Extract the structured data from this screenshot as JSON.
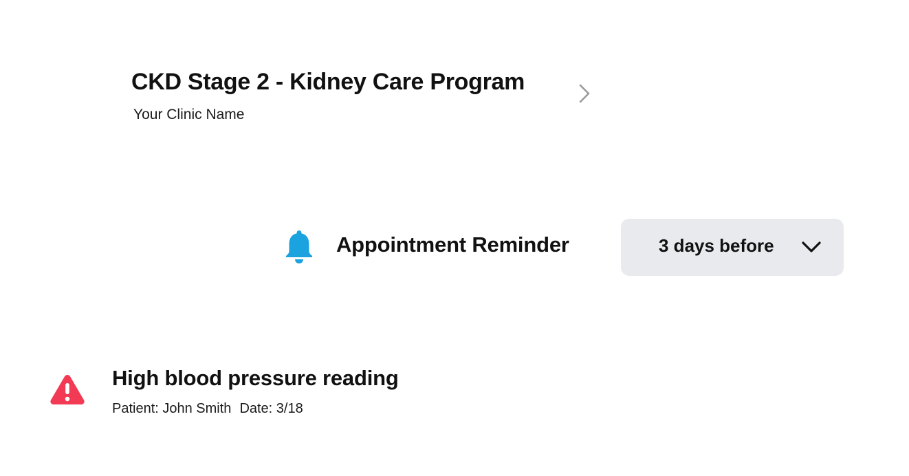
{
  "program": {
    "title": "CKD Stage 2 - Kidney Care Program",
    "clinic_name": "Your Clinic Name",
    "chevron_icon": "chevron-right-icon"
  },
  "reminder": {
    "icon": "bell-icon",
    "icon_color": "#1aa3df",
    "label": "Appointment Reminder",
    "selected_option": "3 days before",
    "dropdown_icon": "chevron-down-icon"
  },
  "alert": {
    "icon": "warning-icon",
    "icon_color": "#f23a54",
    "title": "High blood pressure reading",
    "patient": "Patient: John Smith",
    "date": "Date: 3/18"
  }
}
